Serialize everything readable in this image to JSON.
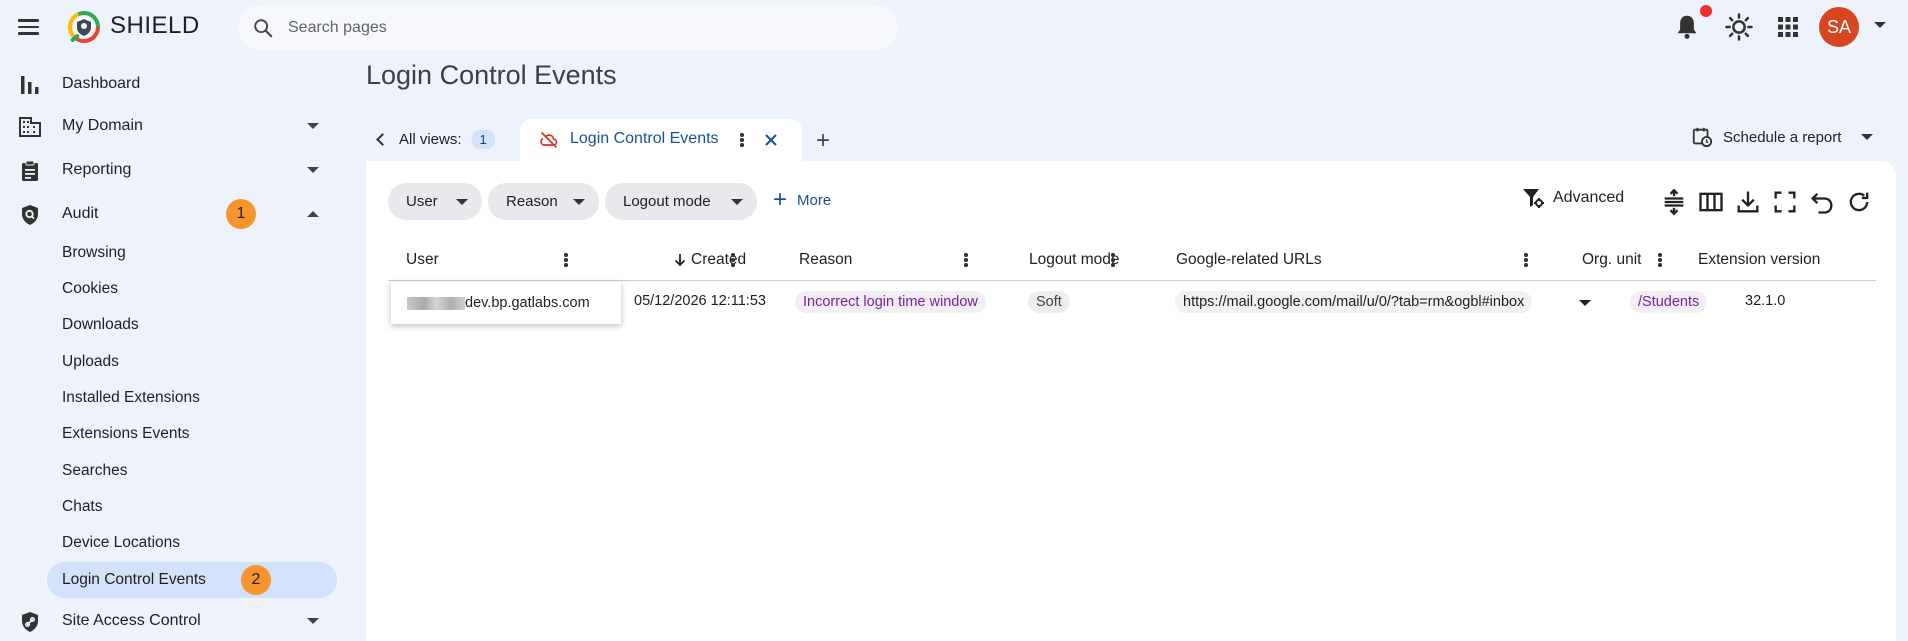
{
  "app": {
    "brand": "SHIELD"
  },
  "search": {
    "placeholder": "Search pages"
  },
  "user": {
    "initials": "SA"
  },
  "colors": {
    "accent": "#1a4f9a",
    "badge": "#f6952e",
    "avatar": "#d8451f",
    "active_nav": "#d3e2fb",
    "notification": "#ea2f2f"
  },
  "sidebar": {
    "items": [
      {
        "label": "Dashboard",
        "icon": "bar-chart-icon"
      },
      {
        "label": "My Domain",
        "icon": "building-icon"
      },
      {
        "label": "Reporting",
        "icon": "clipboard-icon"
      },
      {
        "label": "Audit",
        "icon": "shield-search-icon",
        "badge": "1"
      },
      {
        "label": "Site Access Control",
        "icon": "shield-link-icon"
      }
    ],
    "audit_sub": [
      {
        "label": "Browsing"
      },
      {
        "label": "Cookies"
      },
      {
        "label": "Downloads"
      },
      {
        "label": "Uploads"
      },
      {
        "label": "Installed Extensions"
      },
      {
        "label": "Extensions Events"
      },
      {
        "label": "Searches"
      },
      {
        "label": "Chats"
      },
      {
        "label": "Device Locations"
      },
      {
        "label": "Login Control Events",
        "badge": "2",
        "active": true
      }
    ]
  },
  "main": {
    "title": "Login Control Events",
    "all_views_label": "All views:",
    "all_views_count": "1",
    "active_tab": "Login Control Events",
    "schedule_label": "Schedule a report",
    "filters": [
      "User",
      "Reason",
      "Logout mode"
    ],
    "more_label": "More",
    "advanced_label": "Advanced",
    "columns": [
      "User",
      "Created",
      "Reason",
      "Logout mode",
      "Google-related URLs",
      "Org. unit",
      "Extension version"
    ],
    "rows": [
      {
        "user_suffix": "dev.bp.gatlabs.com",
        "created": "05/12/2026 12:11:53",
        "reason": "Incorrect login time window",
        "logout_mode": "Soft",
        "url": "https://mail.google.com/mail/u/0/?tab=rm&ogbl#inbox",
        "org_unit": "/Students",
        "extension_version": "32.1.0"
      }
    ]
  }
}
